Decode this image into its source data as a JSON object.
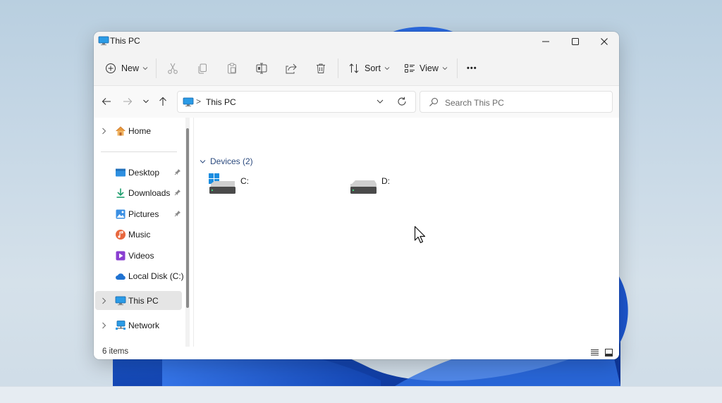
{
  "window": {
    "title": "This PC"
  },
  "toolbar": {
    "new_label": "New",
    "sort_label": "Sort",
    "view_label": "View",
    "more_label": "•••"
  },
  "address": {
    "separator": ">",
    "path": "This PC"
  },
  "search": {
    "placeholder": "Search This PC"
  },
  "sidebar": {
    "items": [
      {
        "label": "Home",
        "icon": "home-icon"
      },
      {
        "label": "Desktop",
        "icon": "desktop-folder-icon",
        "pinned": true
      },
      {
        "label": "Downloads",
        "icon": "downloads-icon",
        "pinned": true
      },
      {
        "label": "Pictures",
        "icon": "pictures-icon",
        "pinned": true
      },
      {
        "label": "Music",
        "icon": "music-icon"
      },
      {
        "label": "Videos",
        "icon": "videos-icon"
      },
      {
        "label": "Local Disk (C:)",
        "icon": "onedrive-cloud-icon"
      },
      {
        "label": "This PC",
        "icon": "this-pc-icon",
        "selected": true
      },
      {
        "label": "Network",
        "icon": "network-icon"
      }
    ]
  },
  "main": {
    "group_header": "Devices (2)",
    "drives": [
      {
        "label": "C:",
        "icon": "system-drive-icon"
      },
      {
        "label": "D:",
        "icon": "drive-icon"
      }
    ]
  },
  "status": {
    "item_count": "6 items"
  },
  "colors": {
    "accent": "#0067c0",
    "group_header": "#2b4a7e",
    "selection": "#e5e5e5"
  }
}
